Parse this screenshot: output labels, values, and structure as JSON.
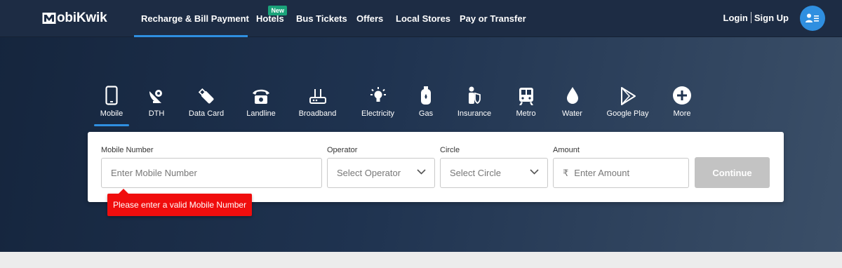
{
  "brand": {
    "logo_text": "obiKwik"
  },
  "nav": {
    "items": [
      {
        "label": "Recharge & Bill Payment",
        "active": true
      },
      {
        "label": "Hotels",
        "badge": "New"
      },
      {
        "label": "Bus Tickets"
      },
      {
        "label": "Offers"
      },
      {
        "label": "Local Stores"
      },
      {
        "label": "Pay or Transfer"
      }
    ]
  },
  "auth": {
    "login": "Login",
    "signup": "Sign Up",
    "avatar_icon": "user-menu-icon"
  },
  "categories": [
    {
      "label": "Mobile",
      "icon": "mobile-icon",
      "active": true
    },
    {
      "label": "DTH",
      "icon": "satellite-dish-icon"
    },
    {
      "label": "Data Card",
      "icon": "usb-data-card-icon"
    },
    {
      "label": "Landline",
      "icon": "telephone-icon"
    },
    {
      "label": "Broadband",
      "icon": "router-icon"
    },
    {
      "label": "Electricity",
      "icon": "bulb-icon"
    },
    {
      "label": "Gas",
      "icon": "gas-cylinder-icon"
    },
    {
      "label": "Insurance",
      "icon": "insurance-icon"
    },
    {
      "label": "Metro",
      "icon": "train-icon"
    },
    {
      "label": "Water",
      "icon": "water-drop-icon"
    },
    {
      "label": "Google Play",
      "icon": "play-store-icon"
    },
    {
      "label": "More",
      "icon": "plus-circle-icon"
    }
  ],
  "form": {
    "mobile": {
      "label": "Mobile Number",
      "placeholder": "Enter Mobile Number"
    },
    "operator": {
      "label": "Operator",
      "placeholder": "Select Operator"
    },
    "circle": {
      "label": "Circle",
      "placeholder": "Select Circle"
    },
    "amount": {
      "label": "Amount",
      "currency": "₹",
      "placeholder": "Enter Amount"
    },
    "continue_label": "Continue",
    "error": "Please enter a valid Mobile Number"
  },
  "colors": {
    "accent": "#2f8fe0",
    "error": "#f00d0d",
    "new_badge": "#1aa37a",
    "button_disabled": "#c3c3c3"
  }
}
